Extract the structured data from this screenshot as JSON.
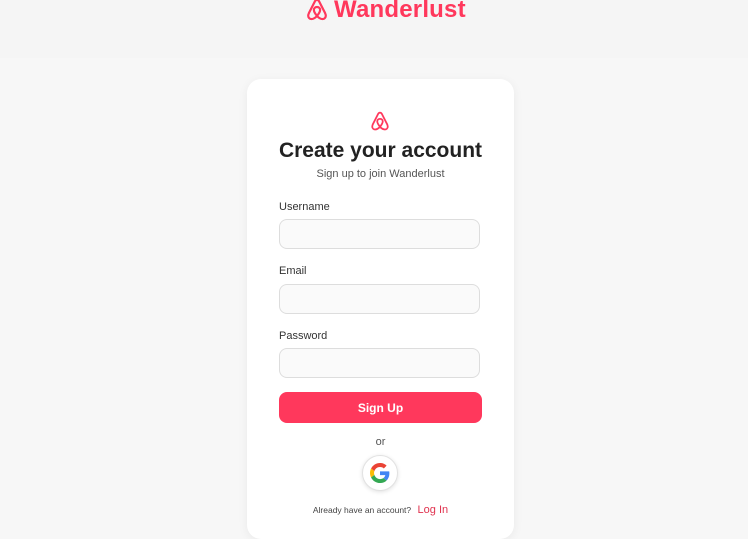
{
  "header": {
    "brand_name": "Wanderlust",
    "brand_icon": "airbnb-logo-icon",
    "brand_color": "#ff385c"
  },
  "signup_card": {
    "logo_icon": "airbnb-logo-icon",
    "title": "Create your account",
    "subtitle": "Sign up to join Wanderlust",
    "fields": {
      "username_label": "Username",
      "username_value": "",
      "email_label": "Email",
      "email_value": "",
      "password_label": "Password",
      "password_value": ""
    },
    "signup_label": "Sign Up",
    "or_label": "or",
    "google_icon": "google-icon",
    "login_prompt": "Already have an account?",
    "login_label": "Log In",
    "accent_color": "#ff385c"
  }
}
